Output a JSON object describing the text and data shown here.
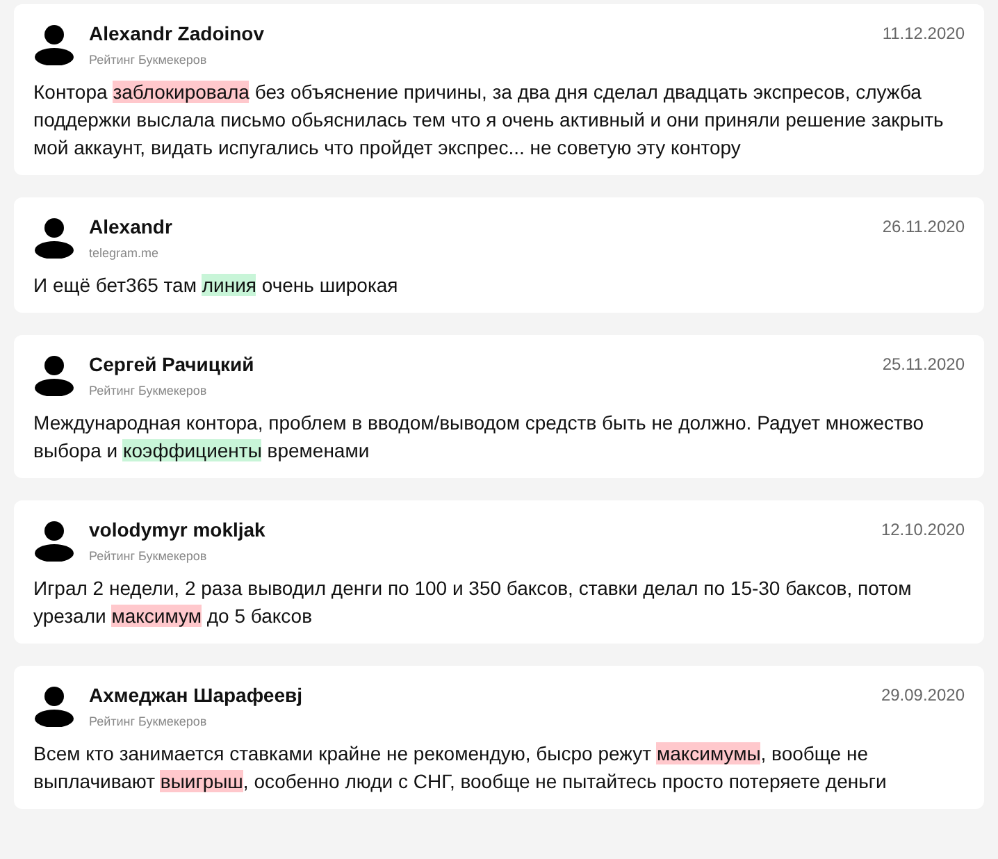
{
  "reviews": [
    {
      "author": "Alexandr Zadoinov",
      "source": "Рейтинг Букмекеров",
      "date": "11.12.2020",
      "text": [
        {
          "kind": "plain",
          "text": "Контора "
        },
        {
          "kind": "negative",
          "text": "заблокировала"
        },
        {
          "kind": "plain",
          "text": " без объяснение причины, за два дня сделал двадцать экспресов, служба поддержки выслала письмо обьяснилась тем что я очень активный и они приняли решение закрыть мой аккаунт, видать испугались что пройдет экспрес... не советую эту контору"
        }
      ]
    },
    {
      "author": "Alexandr",
      "source": "telegram.me",
      "date": "26.11.2020",
      "text": [
        {
          "kind": "plain",
          "text": "И ещё бет365 там "
        },
        {
          "kind": "positive",
          "text": "линия"
        },
        {
          "kind": "plain",
          "text": " очень широкая"
        }
      ]
    },
    {
      "author": "Сергей Рачицкий",
      "source": "Рейтинг Букмекеров",
      "date": "25.11.2020",
      "text": [
        {
          "kind": "plain",
          "text": "Международная контора, проблем в вводом/выводом средств быть не должно. Радует множество выбора и "
        },
        {
          "kind": "positive",
          "text": "коэффициенты"
        },
        {
          "kind": "plain",
          "text": " временами"
        }
      ]
    },
    {
      "author": "volodymyr mokljak",
      "source": "Рейтинг Букмекеров",
      "date": "12.10.2020",
      "text": [
        {
          "kind": "plain",
          "text": "Играл 2 недели, 2 раза выводил денги по 100 и 350 баксов, ставки делал по 15-30 баксов, потом урезали "
        },
        {
          "kind": "negative",
          "text": "максимум"
        },
        {
          "kind": "plain",
          "text": " до 5 баксов"
        }
      ]
    },
    {
      "author": "Ахмеджан Шарафеевј",
      "source": "Рейтинг Букмекеров",
      "date": "29.09.2020",
      "text": [
        {
          "kind": "plain",
          "text": "Всем кто занимается ставками крайне не рекомендую, бысро режут "
        },
        {
          "kind": "negative",
          "text": "максимумы"
        },
        {
          "kind": "plain",
          "text": ", вообще не выплачивают "
        },
        {
          "kind": "negative",
          "text": "выигрыш"
        },
        {
          "kind": "plain",
          "text": ", особенно люди с СНГ, вообще не пытайтесь просто потеряете деньги"
        }
      ]
    }
  ]
}
